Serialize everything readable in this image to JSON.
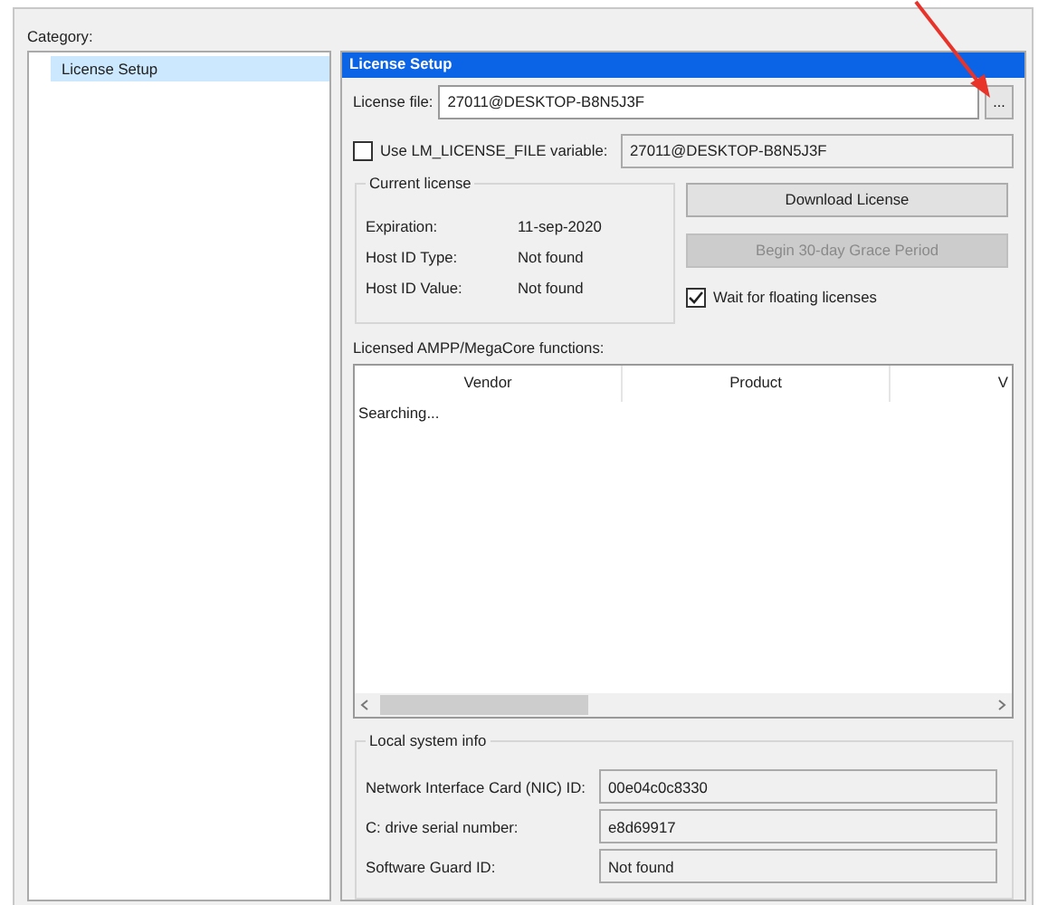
{
  "category_label": "Category:",
  "tree": [
    {
      "label": "License Setup",
      "selected": true
    }
  ],
  "panel_title": "License Setup",
  "license_file": {
    "label": "License file:",
    "value": "27011@DESKTOP-B8N5J3F",
    "browse": "..."
  },
  "lm_variable": {
    "label": "Use LM_LICENSE_FILE variable:",
    "checked": false,
    "value": "27011@DESKTOP-B8N5J3F"
  },
  "current_license": {
    "title": "Current license",
    "rows": [
      {
        "label": "Expiration:",
        "value": "11-sep-2020"
      },
      {
        "label": "Host ID Type:",
        "value": "Not found"
      },
      {
        "label": "Host ID Value:",
        "value": "Not found"
      }
    ]
  },
  "buttons": [
    {
      "label": "Download License",
      "disabled": false
    },
    {
      "label": "Begin 30-day Grace Period",
      "disabled": true
    }
  ],
  "wait_floating": {
    "label": "Wait for floating licenses",
    "checked": true
  },
  "functions": {
    "label": "Licensed AMPP/MegaCore functions:",
    "columns": [
      "Vendor",
      "Product",
      "V"
    ],
    "status": "Searching..."
  },
  "local_info": {
    "title": "Local system info",
    "rows": [
      {
        "label": "Network Interface Card (NIC) ID:",
        "value": "00e04c0c8330"
      },
      {
        "label": "C: drive serial number:",
        "value": "e8d69917"
      },
      {
        "label": "Software Guard ID:",
        "value": "Not found"
      }
    ]
  }
}
